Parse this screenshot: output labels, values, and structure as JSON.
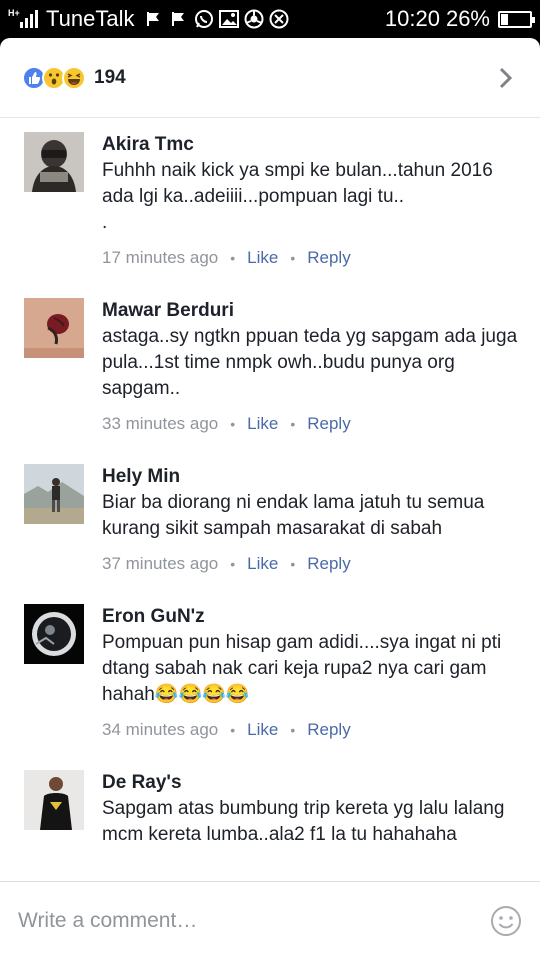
{
  "status_bar": {
    "signal_label": "H+",
    "carrier": "TuneTalk",
    "time": "10:20",
    "battery": "26%",
    "battery_level": 0.26,
    "icons": [
      "flag-icon",
      "flag-icon",
      "whatsapp-icon",
      "gallery-icon",
      "chrome-icon",
      "close-circle-icon"
    ]
  },
  "reactions": {
    "types": [
      "like",
      "wow",
      "haha"
    ],
    "count": "194"
  },
  "comments": [
    {
      "author": "Akira Tmc",
      "text": "Fuhhh naik kick ya smpi ke bulan...tahun 2016 ada lgi ka..adeiiii...pompuan lagi tu..\n.",
      "time": "17 minutes ago",
      "like": "Like",
      "reply": "Reply"
    },
    {
      "author": "Mawar Berduri",
      "text": "astaga..sy ngtkn ppuan teda yg sapgam ada juga pula...1st time nmpk owh..budu punya org sapgam..",
      "time": "33 minutes ago",
      "like": "Like",
      "reply": "Reply"
    },
    {
      "author": "Hely Min",
      "text": "Biar ba diorang ni endak lama jatuh tu semua kurang sikit sampah masarakat di sabah",
      "time": "37 minutes ago",
      "like": "Like",
      "reply": "Reply"
    },
    {
      "author": "Eron GuN'z",
      "text": "Pompuan pun hisap gam adidi....sya ingat ni pti dtang sabah nak cari keja rupa2 nya cari gam hahah😂😂😂😂",
      "time": "34 minutes ago",
      "like": "Like",
      "reply": "Reply"
    },
    {
      "author": "De Ray's",
      "text": "Sapgam atas bumbung trip kereta yg lalu lalang mcm kereta lumba..ala2 f1 la tu hahahaha",
      "time": "",
      "like": "",
      "reply": ""
    }
  ],
  "composer": {
    "placeholder": "Write a comment…"
  },
  "colors": {
    "link": "#4b6aa8",
    "meta": "#90949c",
    "like_reaction": "#4e80ee",
    "emoji_reaction": "#f7c631"
  }
}
